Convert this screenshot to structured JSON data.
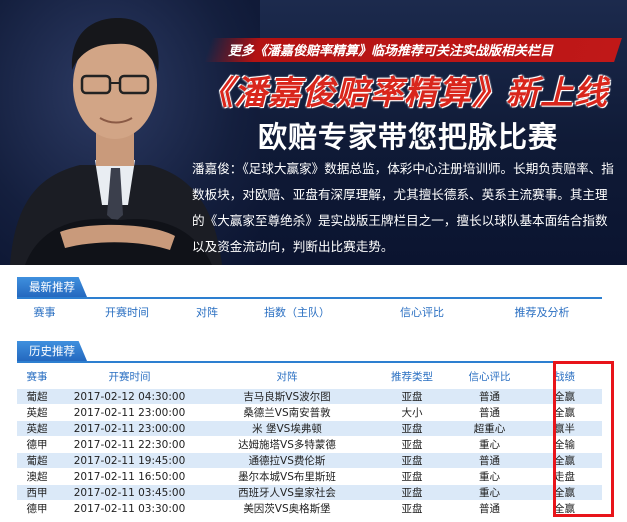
{
  "banner": {
    "strip_text": "更多《潘嘉俊赔率精算》临场推荐可关注实战版相关栏目",
    "title1": "《潘嘉俊赔率精算》新上线",
    "title2": "欧赔专家带您把脉比赛",
    "description": "潘嘉俊：《足球大赢家》数据总监，体彩中心注册培训师。长期负责赔率、指数板块，对欧赔、亚盘有深厚理解，尤其擅长德系、英系主流赛事。其主理的《大赢家至尊绝杀》是实战版王牌栏目之一，擅长以球队基本面结合指数以及资金流动向，判断出比赛走势。"
  },
  "latest": {
    "tab": "最新推荐",
    "columns": [
      "赛事",
      "开赛时间",
      "对阵",
      "指数（主队）",
      "信心评比",
      "推荐及分析"
    ]
  },
  "history": {
    "tab": "历史推荐",
    "columns": [
      "赛事",
      "开赛时间",
      "对阵",
      "推荐类型",
      "信心评比",
      "战绩"
    ],
    "rows": [
      [
        "葡超",
        "2017-02-12 04:30:00",
        "吉马良斯VS波尔图",
        "亚盘",
        "普通",
        "全赢"
      ],
      [
        "英超",
        "2017-02-11 23:00:00",
        "桑德兰VS南安普敦",
        "大小",
        "普通",
        "全赢"
      ],
      [
        "英超",
        "2017-02-11 23:00:00",
        "米 堡VS埃弗顿",
        "亚盘",
        "超重心",
        "赢半"
      ],
      [
        "德甲",
        "2017-02-11 22:30:00",
        "达姆施塔VS多特蒙德",
        "亚盘",
        "重心",
        "全输"
      ],
      [
        "葡超",
        "2017-02-11 19:45:00",
        "通德拉VS费伦斯",
        "亚盘",
        "普通",
        "全赢"
      ],
      [
        "澳超",
        "2017-02-11 16:50:00",
        "墨尔本城VS布里斯班",
        "亚盘",
        "重心",
        "走盘"
      ],
      [
        "西甲",
        "2017-02-11 03:45:00",
        "西班牙人VS皇家社会",
        "亚盘",
        "重心",
        "全赢"
      ],
      [
        "德甲",
        "2017-02-11 03:30:00",
        "美因茨VS奥格斯堡",
        "亚盘",
        "普通",
        "全赢"
      ]
    ]
  },
  "colors": {
    "accent": "#2d7fd0",
    "highlight_border": "#e8141a",
    "title_red": "#d9261c"
  }
}
